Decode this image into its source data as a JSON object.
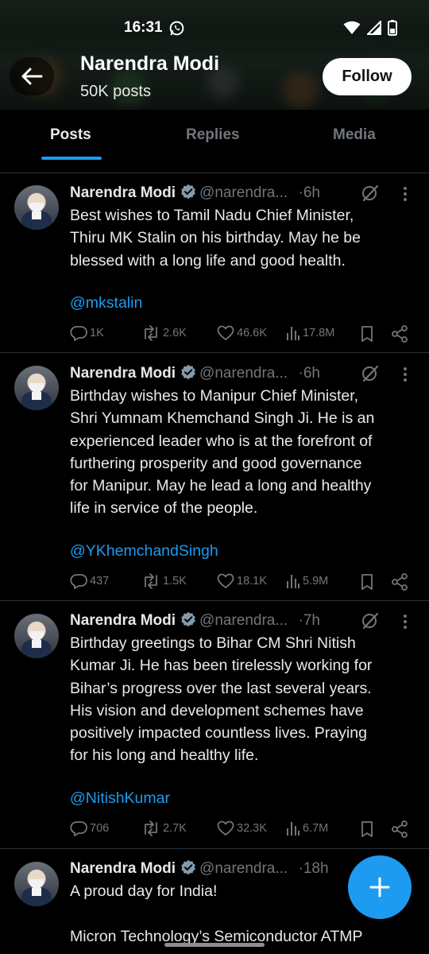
{
  "status_bar": {
    "time": "16:31"
  },
  "profile": {
    "name": "Narendra Modi",
    "posts_count": "50K posts",
    "follow_label": "Follow"
  },
  "tabs": [
    {
      "label": "Posts",
      "active": true
    },
    {
      "label": "Replies",
      "active": false
    },
    {
      "label": "Media",
      "active": false
    }
  ],
  "posts": [
    {
      "author": "Narendra Modi",
      "handle": "@narendra...",
      "age": "·6h",
      "lines": [
        "Best wishes to Tamil Nadu Chief Minister,",
        "Thiru MK Stalin on his birthday. May he be",
        "blessed with a long life and good health."
      ],
      "mention": "@mkstalin",
      "replies": "1K",
      "reposts": "2.6K",
      "likes": "46.6K",
      "views": "17.8M"
    },
    {
      "author": "Narendra Modi",
      "handle": "@narendra...",
      "age": "·6h",
      "lines": [
        "Birthday wishes to Manipur Chief Minister,",
        "Shri Yumnam Khemchand Singh Ji. He is an",
        "experienced leader who is at the forefront of",
        "furthering prosperity and good governance",
        "for Manipur. May he lead a long and healthy",
        "life in service of the people."
      ],
      "mention": "@YKhemchandSingh",
      "replies": "437",
      "reposts": "1.5K",
      "likes": "18.1K",
      "views": "5.9M"
    },
    {
      "author": "Narendra Modi",
      "handle": "@narendra...",
      "age": "·7h",
      "lines": [
        "Birthday greetings to Bihar CM Shri Nitish",
        "Kumar Ji. He has been tirelessly working for",
        "Bihar’s progress over the last several years.",
        "His vision and development schemes have",
        "positively impacted countless lives. Praying",
        "for his long and healthy life."
      ],
      "mention": "@NitishKumar",
      "replies": "706",
      "reposts": "2.7K",
      "likes": "32.3K",
      "views": "6.7M"
    },
    {
      "author": "Narendra Modi",
      "handle": "@narendra...",
      "age": "·18h",
      "lines": [
        "A proud day for India!",
        "",
        "Micron Technology’s Semiconductor ATMP"
      ]
    }
  ],
  "icons": {
    "back": "arrow-left-icon",
    "verified": "verified-badge-icon",
    "grok": "grok-icon",
    "more": "more-vertical-icon",
    "reply": "reply-icon",
    "repost": "repost-icon",
    "like": "like-icon",
    "views": "views-icon",
    "bookmark": "bookmark-icon",
    "share": "share-icon",
    "compose": "plus-icon"
  },
  "colors": {
    "accent": "#1d9bf0",
    "background": "#000000",
    "muted": "#71767b",
    "divider": "#2f3336"
  }
}
